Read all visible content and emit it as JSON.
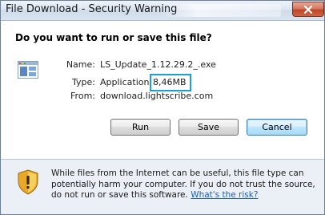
{
  "window": {
    "title": "File Download - Security Warning"
  },
  "dialog": {
    "question": "Do you want to run or save this file?",
    "fields": {
      "name_label": "Name:",
      "name_value": "LS_Update_1.12.29.2_.exe",
      "type_label": "Type:",
      "type_value": "Application,",
      "type_size": "8,46MB",
      "from_label": "From:",
      "from_value": "download.lightscribe.com"
    },
    "buttons": {
      "run": "Run",
      "save": "Save",
      "cancel": "Cancel"
    },
    "warning": {
      "text": "While files from the Internet can be useful, this file type can potentially harm your computer. If you do not trust the source, do not run or save this software.",
      "link": "What's the risk?"
    }
  },
  "colors": {
    "highlight_box": "#1aa0d8",
    "link": "#1e5fb8",
    "close_button": "#c0472a"
  },
  "icons": {
    "close": "close-icon",
    "application": "application-icon",
    "warning": "security-shield-icon"
  }
}
